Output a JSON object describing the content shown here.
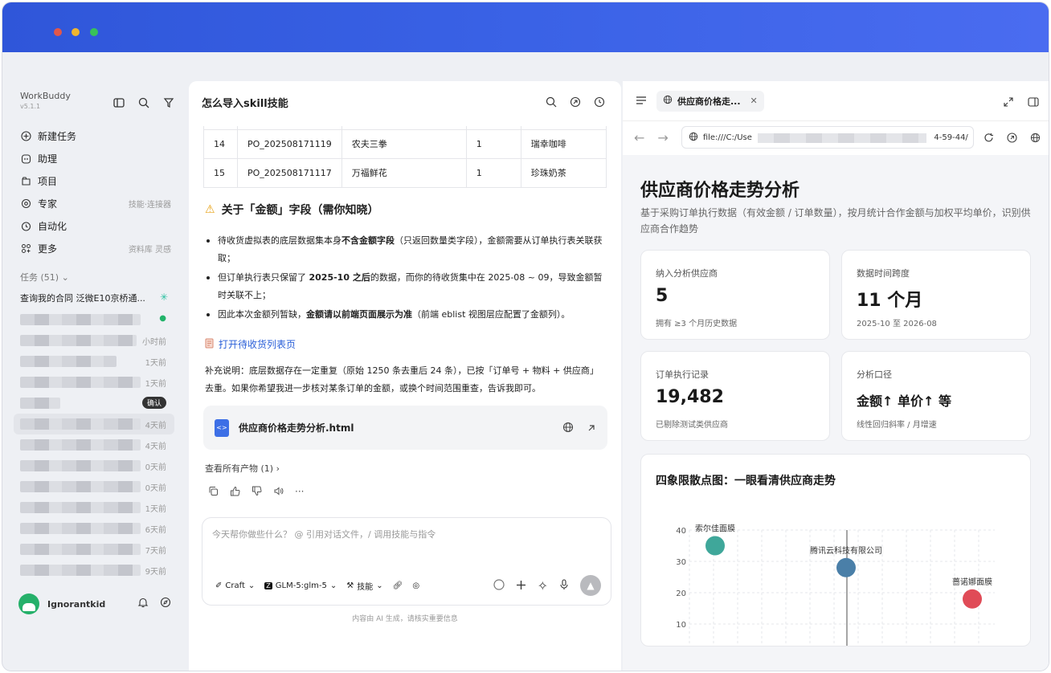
{
  "sidebar": {
    "brand": "WorkBuddy",
    "version": "v5.1.1",
    "nav": [
      {
        "label": "新建任务",
        "hint": ""
      },
      {
        "label": "助理",
        "hint": ""
      },
      {
        "label": "项目",
        "hint": ""
      },
      {
        "label": "专家",
        "hint": "技能·连接器"
      },
      {
        "label": "自动化",
        "hint": ""
      },
      {
        "label": "更多",
        "hint": "资料库 灵感"
      }
    ],
    "tasks_header": "任务 (51)",
    "first_task": "查询我的合同 泛微E10京桥通...",
    "task_times": [
      "",
      "小时前",
      "1天前",
      "1天前",
      "确认",
      "4天前",
      "4天前",
      "0天前",
      "0天前",
      "1天前",
      "6天前",
      "7天前",
      "9天前"
    ],
    "user": "Ignorantkid"
  },
  "chat": {
    "title": "怎么导入skill技能",
    "table_rows": [
      [
        "14",
        "PO_202508171119",
        "农夫三拳",
        "1",
        "瑞幸咖啡"
      ],
      [
        "15",
        "PO_202508171117",
        "万福鲜花",
        "1",
        "珍珠奶茶"
      ]
    ],
    "section_title": "关于「金额」字段（需你知晓）",
    "bullets": [
      {
        "pre": "待收货虚拟表的底层数据集本身",
        "bold": "不含金额字段",
        "post": "（只返回数量类字段），金额需要从订单执行表关联获取；"
      },
      {
        "pre": "但订单执行表只保留了 ",
        "bold": "2025-10 之后",
        "post": "的数据，而你的待收货集中在 2025-08 ~ 09，导致金额暂时关联不上；"
      },
      {
        "pre": "因此本次金额列暂缺，",
        "bold": "金额请以前端页面展示为准",
        "post": "（前端 eblist 视图层应配置了金额列）。"
      }
    ],
    "link": "打开待收货列表页",
    "supplement": "补充说明：底层数据存在一定重复（原始 1250 条去重后 24 条），已按「订单号 + 物料 + 供应商」去重。如果你希望我进一步核对某条订单的金额，或换个时间范围重查，告诉我即可。",
    "file_name": "供应商价格走势分析.html",
    "view_all": "查看所有产物 (1)",
    "input_placeholder": "今天帮你做些什么？ @ 引用对话文件，/ 调用技能与指令",
    "tools": {
      "mode": "Craft",
      "model": "GLM-5:glm-5",
      "skills": "技能"
    },
    "disclaimer": "内容由 AI 生成，请核实重要信息"
  },
  "preview": {
    "tab_title": "供应商价格走...",
    "url_start": "file:///C:/Use",
    "url_end": "4-59-44/",
    "page_title": "供应商价格走势分析",
    "page_subtitle": "基于采购订单执行数据（有效金额 / 订单数量），按月统计合作金额与加权平均单价，识别供应商合作趋势",
    "cards": [
      {
        "label": "纳入分析供应商",
        "value": "5",
        "note": "拥有 ≥3 个月历史数据"
      },
      {
        "label": "数据时间跨度",
        "value": "11 个月",
        "note": "2025-10 至 2026-08"
      },
      {
        "label": "订单执行记录",
        "value": "19,482",
        "note": "已剔除测试类供应商"
      },
      {
        "label": "分析口径",
        "value": "金额↑ 单价↑ 等",
        "note": "线性回归斜率 / 月增速"
      }
    ],
    "chart_title": "四象限散点图：一眼看清供应商走势"
  },
  "chart_data": {
    "type": "scatter",
    "title": "四象限散点图：一眼看清供应商走势",
    "y_ticks": [
      10,
      20,
      30,
      40
    ],
    "points": [
      {
        "label": "索尔佳面膜",
        "y": 35,
        "color": "#3fa79a"
      },
      {
        "label": "腾讯云科技有限公司",
        "y": 28,
        "color": "#4a7fa8"
      },
      {
        "label": "蔷诺娜面膜",
        "y": 18,
        "color": "#e04b57"
      }
    ]
  }
}
